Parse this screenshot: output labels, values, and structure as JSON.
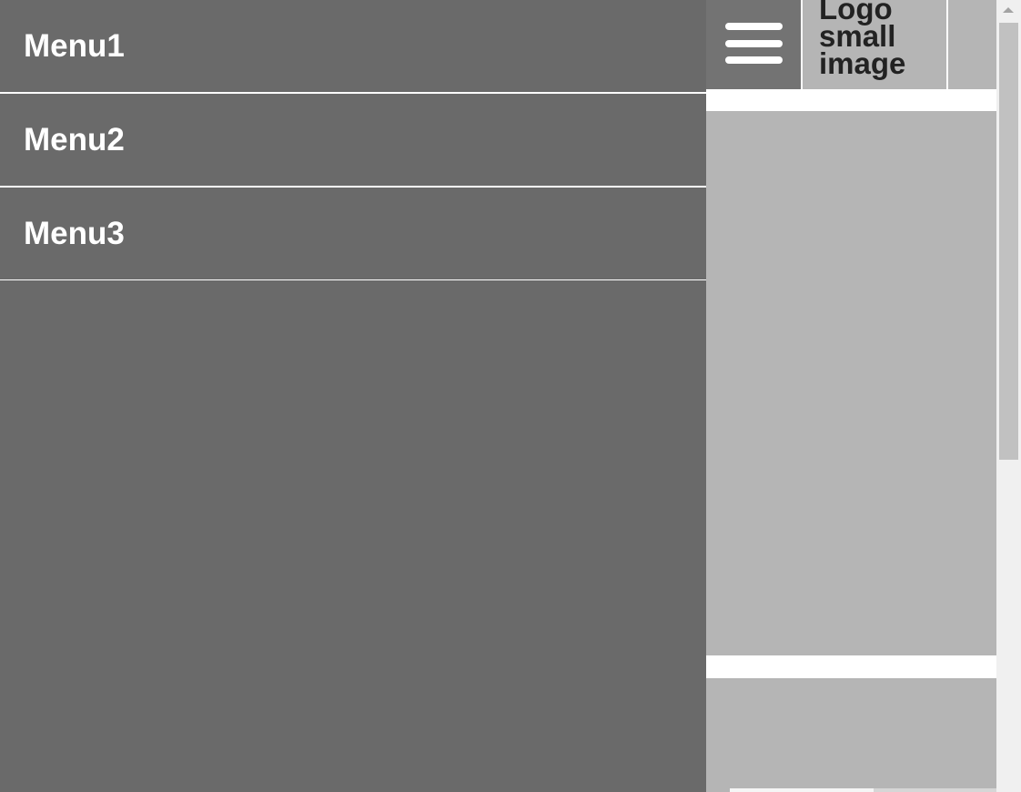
{
  "menu": {
    "items": [
      {
        "label": "Menu1"
      },
      {
        "label": "Menu2"
      },
      {
        "label": "Menu3"
      }
    ]
  },
  "header": {
    "logo_text": [
      "Logo",
      "small",
      "image"
    ]
  }
}
